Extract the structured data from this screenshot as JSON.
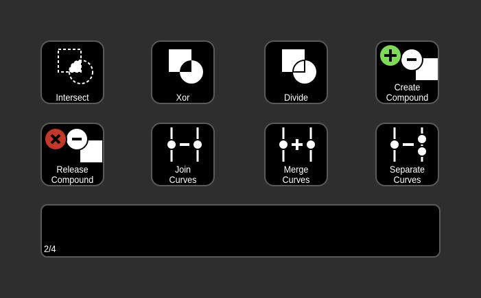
{
  "buttons": [
    {
      "id": "intersect",
      "lines": [
        "Intersect"
      ],
      "icon": "intersect-icon"
    },
    {
      "id": "xor",
      "lines": [
        "Xor"
      ],
      "icon": "xor-icon"
    },
    {
      "id": "divide",
      "lines": [
        "Divide"
      ],
      "icon": "divide-icon"
    },
    {
      "id": "create-compound",
      "lines": [
        "Create",
        "Compound"
      ],
      "icon": "create-compound-icon"
    },
    {
      "id": "release-compound",
      "lines": [
        "Release",
        "Compound"
      ],
      "icon": "release-compound-icon"
    },
    {
      "id": "join-curves",
      "lines": [
        "Join",
        "Curves"
      ],
      "icon": "join-curves-icon"
    },
    {
      "id": "merge-curves",
      "lines": [
        "Merge",
        "Curves"
      ],
      "icon": "merge-curves-icon"
    },
    {
      "id": "separate-curves",
      "lines": [
        "Separate",
        "Curves"
      ],
      "icon": "separate-curves-icon"
    }
  ],
  "status": {
    "page_indicator": "2/4"
  },
  "colors": {
    "background": "#2e2e2e",
    "button_fill": "#000000",
    "button_border": "#5a5a5a",
    "add_badge": "#7ed957",
    "remove_badge": "#c0392b"
  }
}
